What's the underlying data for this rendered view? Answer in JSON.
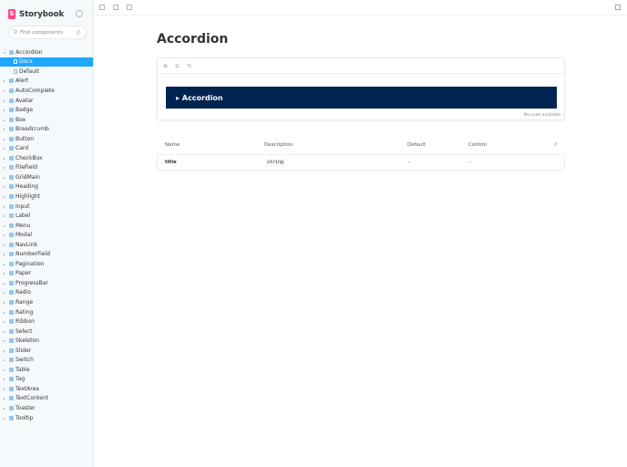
{
  "brand": {
    "logo_letter": "S",
    "name": "Storybook"
  },
  "search": {
    "placeholder": "Find components",
    "shortcut": "/"
  },
  "tree": {
    "root": "Accordion",
    "children": [
      "Docs",
      "Default"
    ],
    "items": [
      "Alert",
      "AutoComplete",
      "Avatar",
      "Badge",
      "Box",
      "Breadcrumb",
      "Button",
      "Card",
      "CheckBox",
      "FileField",
      "GridMain",
      "Heading",
      "Highlight",
      "Input",
      "Label",
      "Menu",
      "Modal",
      "NavLink",
      "NumberField",
      "Pagination",
      "Paper",
      "ProgressBar",
      "Radio",
      "Range",
      "Rating",
      "Ribbon",
      "Select",
      "Skeleton",
      "Slider",
      "Switch",
      "Table",
      "Tag",
      "TextArea",
      "TextContent",
      "Toaster",
      "Tooltip"
    ]
  },
  "page": {
    "title": "Accordion",
    "preview_label": "▸ Accordion",
    "no_code": "No code available"
  },
  "table": {
    "headers": [
      "Name",
      "Description",
      "Default",
      "Control"
    ],
    "row": {
      "name": "title",
      "description": "string",
      "default": "-",
      "control": "-"
    }
  },
  "colors": {
    "accent": "#1ea7fd",
    "preview_bg": "#002451",
    "brand": "#ff4785"
  }
}
